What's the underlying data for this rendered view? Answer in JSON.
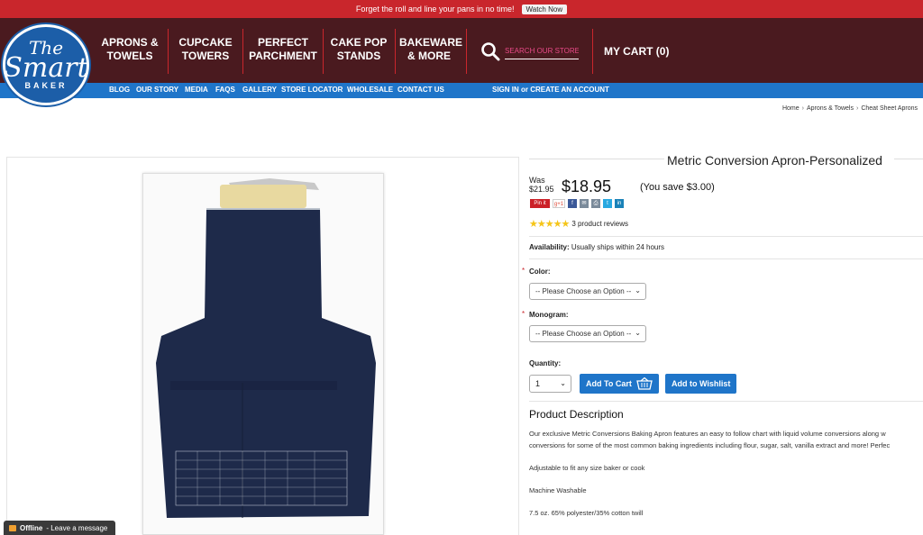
{
  "promo": {
    "text": "Forget the roll and line your pans in no time!",
    "button": "Watch Now"
  },
  "logo": {
    "line1": "The",
    "line2": "Smart",
    "line3": "BAKER"
  },
  "main_nav": [
    "APRONS &\nTOWELS",
    "CUPCAKE\nTOWERS",
    "PERFECT\nPARCHMENT",
    "CAKE POP\nSTANDS",
    "BAKEWARE\n& MORE"
  ],
  "search": {
    "placeholder": "SEARCH OUR STORE"
  },
  "cart": "MY CART (0)",
  "sub_nav": [
    "BLOG",
    "OUR STORY",
    "MEDIA",
    "FAQS",
    "GALLERY",
    "STORE LOCATOR",
    "WHOLESALE",
    "CONTACT US"
  ],
  "account_link": "SIGN IN or CREATE AN ACCOUNT",
  "breadcrumb": [
    "Home",
    "Aprons & Towels",
    "Cheat Sheet Aprons"
  ],
  "product": {
    "title": "Metric Conversion Apron-Personalized",
    "was_label": "Was",
    "was_price": "$21.95",
    "price": "$18.95",
    "savings": "(You save $3.00)",
    "rating_stars": 5,
    "reviews": "3 product reviews",
    "availability_label": "Availability:",
    "availability": "Usually ships within 24 hours",
    "color_label": "Color:",
    "monogram_label": "Monogram:",
    "option_placeholder": "-- Please Choose an Option --",
    "quantity_label": "Quantity:",
    "quantity": "1",
    "add_to_cart": "Add To Cart",
    "add_to_wishlist": "Add to Wishlist",
    "description_title": "Product Description",
    "description": [
      "Our exclusive Metric Conversions Baking Apron features an easy to follow chart with liquid volume conversions along w",
      "conversions for some of the most common baking ingredients including flour, sugar, salt, vanilla extract and more! Perfec",
      "Adjustable to fit any size baker or cook",
      "Machine Washable",
      "7.5 oz. 65% polyester/35% cotton twill"
    ]
  },
  "social": [
    "Pin it",
    "g+1",
    "f",
    "✉",
    "⎙",
    "t",
    "in"
  ],
  "chat": {
    "status": "Offline",
    "text": "- Leave a message"
  },
  "colors": {
    "promo": "#c9262c",
    "header": "#4a1a1f",
    "subnav": "#1f75c9",
    "button": "#1f75c9",
    "stars": "#f5c518"
  }
}
